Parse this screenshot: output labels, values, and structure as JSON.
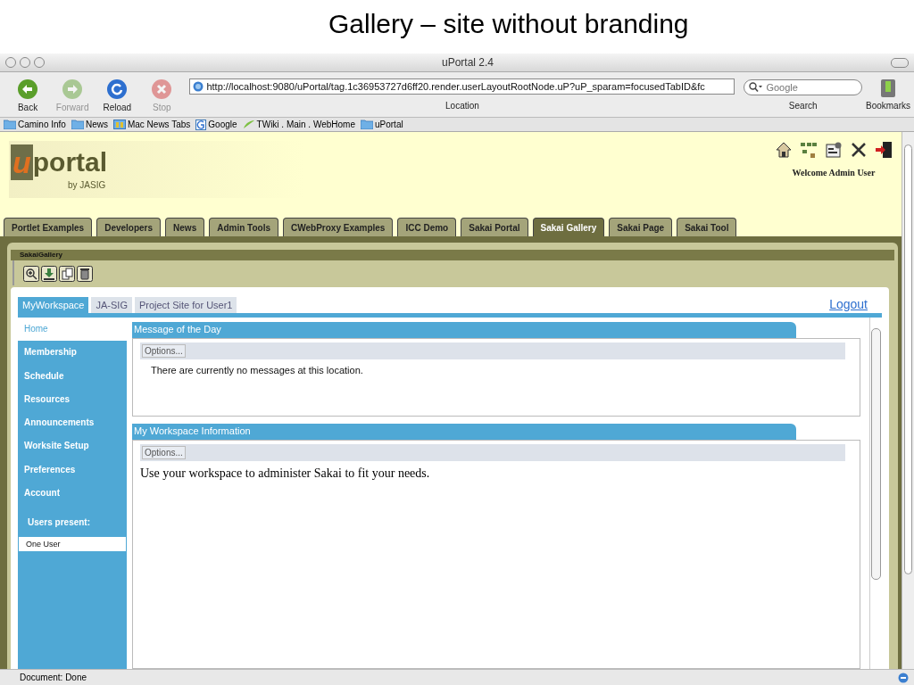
{
  "slide_title": "Gallery – site without branding",
  "window": {
    "title": "uPortal 2.4"
  },
  "toolbar": {
    "buttons": [
      {
        "kind": "back",
        "label": "Back",
        "disabled": false
      },
      {
        "kind": "forward",
        "label": "Forward",
        "disabled": true
      },
      {
        "kind": "reload",
        "label": "Reload",
        "disabled": false
      },
      {
        "kind": "stop",
        "label": "Stop",
        "disabled": true
      }
    ],
    "location": {
      "value": "http://localhost:9080/uPortal/tag.1c36953727d6ff20.render.userLayoutRootNode.uP?uP_sparam=focusedTabID&fc",
      "label": "Location"
    },
    "search": {
      "placeholder": "Google",
      "label": "Search"
    },
    "bookmarks_label": "Bookmarks"
  },
  "bookmarks_bar": [
    {
      "kind": "folder",
      "label": "Camino Info"
    },
    {
      "kind": "folder",
      "label": "News"
    },
    {
      "kind": "tabs",
      "label": "Mac News Tabs"
    },
    {
      "kind": "google",
      "label": "Google"
    },
    {
      "kind": "leaf",
      "label": "TWiki . Main . WebHome"
    },
    {
      "kind": "folder",
      "label": "uPortal"
    }
  ],
  "portal": {
    "logo": {
      "mark": "u",
      "name": "portal",
      "byline": "by JASIG"
    },
    "welcome": "Welcome Admin User",
    "tabs": [
      {
        "label": "Portlet Examples",
        "selected": false
      },
      {
        "label": "Developers",
        "selected": false
      },
      {
        "label": "News",
        "selected": false
      },
      {
        "label": "Admin Tools",
        "selected": false
      },
      {
        "label": "CWebProxy Examples",
        "selected": false
      },
      {
        "label": "ICC Demo",
        "selected": false
      },
      {
        "label": "Sakai Portal",
        "selected": false
      },
      {
        "label": "Sakai Gallery",
        "selected": true
      },
      {
        "label": "Sakai Page",
        "selected": false
      },
      {
        "label": "Sakai Tool",
        "selected": false
      }
    ],
    "channel_title": "SakaiGallery"
  },
  "sakai": {
    "site_tabs": [
      {
        "label": "MyWorkspace",
        "selected": true
      },
      {
        "label": "JA-SIG",
        "selected": false
      },
      {
        "label": "Project Site for User1",
        "selected": false
      }
    ],
    "logout": "Logout",
    "nav": [
      {
        "label": "Home",
        "selected": true
      },
      {
        "label": "Membership",
        "selected": false
      },
      {
        "label": "Schedule",
        "selected": false
      },
      {
        "label": "Resources",
        "selected": false
      },
      {
        "label": "Announcements",
        "selected": false
      },
      {
        "label": "Worksite Setup",
        "selected": false
      },
      {
        "label": "Preferences",
        "selected": false
      },
      {
        "label": "Account",
        "selected": false
      }
    ],
    "users_present": "Users present:",
    "users": [
      "One User"
    ],
    "portlets": [
      {
        "title": "Message of the Day",
        "options": "Options...",
        "kind": "notice",
        "message": "There are currently no messages at this location."
      },
      {
        "title": "My Workspace Information",
        "options": "Options...",
        "kind": "html",
        "message": "Use your workspace to administer Sakai to fit your needs."
      }
    ]
  },
  "status_bar": "Document: Done"
}
